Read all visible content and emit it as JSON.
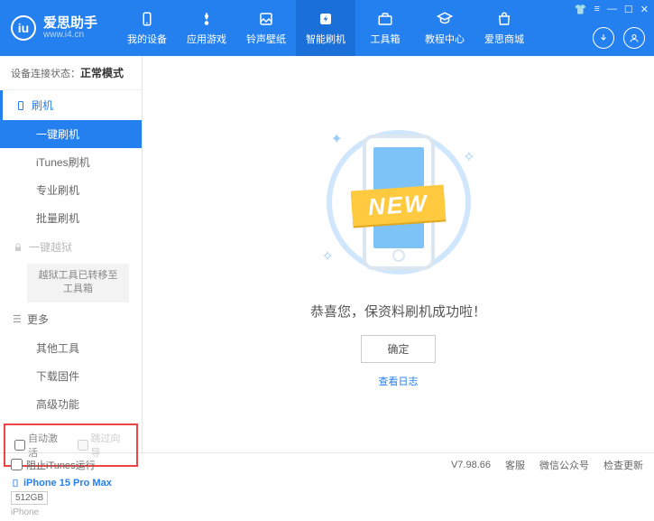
{
  "header": {
    "logo_text": "爱思助手",
    "logo_sub": "www.i4.cn",
    "nav": [
      {
        "label": "我的设备"
      },
      {
        "label": "应用游戏"
      },
      {
        "label": "铃声壁纸"
      },
      {
        "label": "智能刷机"
      },
      {
        "label": "工具箱"
      },
      {
        "label": "教程中心"
      },
      {
        "label": "爱思商城"
      }
    ]
  },
  "sidebar": {
    "conn_label": "设备连接状态：",
    "conn_value": "正常模式",
    "section_flash": "刷机",
    "items_flash": [
      "一键刷机",
      "iTunes刷机",
      "专业刷机",
      "批量刷机"
    ],
    "section_jailbreak": "一键越狱",
    "jailbreak_note": "越狱工具已转移至工具箱",
    "section_more": "更多",
    "items_more": [
      "其他工具",
      "下载固件",
      "高级功能"
    ],
    "checkbox_auto_activate": "自动激活",
    "checkbox_skip_guide": "跳过向导",
    "device": {
      "name": "iPhone 15 Pro Max",
      "capacity": "512GB",
      "type": "iPhone"
    }
  },
  "main": {
    "banner_text": "NEW",
    "success_text": "恭喜您，保资料刷机成功啦！",
    "ok_button": "确定",
    "log_link": "查看日志"
  },
  "footer": {
    "block_itunes": "阻止iTunes运行",
    "version": "V7.98.66",
    "links": [
      "客服",
      "微信公众号",
      "检查更新"
    ]
  }
}
